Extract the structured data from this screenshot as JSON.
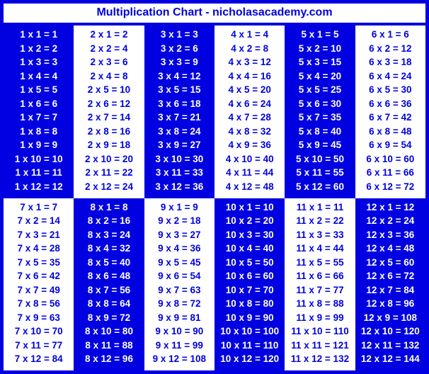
{
  "title": "Multiplication Chart - nicholasacademy.com",
  "chart_data": {
    "type": "table",
    "title": "Multiplication Chart - nicholasacademy.com",
    "multiplicands": [
      1,
      2,
      3,
      4,
      5,
      6,
      7,
      8,
      9,
      10,
      11,
      12
    ],
    "multipliers": [
      1,
      2,
      3,
      4,
      5,
      6,
      7,
      8,
      9,
      10,
      11,
      12
    ],
    "series": [
      {
        "name": "1",
        "values": [
          1,
          2,
          3,
          4,
          5,
          6,
          7,
          8,
          9,
          10,
          11,
          12
        ]
      },
      {
        "name": "2",
        "values": [
          2,
          4,
          6,
          8,
          10,
          12,
          14,
          16,
          18,
          20,
          22,
          24
        ]
      },
      {
        "name": "3",
        "values": [
          3,
          6,
          9,
          12,
          15,
          18,
          21,
          24,
          27,
          30,
          33,
          36
        ]
      },
      {
        "name": "4",
        "values": [
          4,
          8,
          12,
          16,
          20,
          24,
          28,
          32,
          36,
          40,
          44,
          48
        ]
      },
      {
        "name": "5",
        "values": [
          5,
          10,
          15,
          20,
          25,
          30,
          35,
          40,
          45,
          50,
          55,
          60
        ]
      },
      {
        "name": "6",
        "values": [
          6,
          12,
          18,
          24,
          30,
          36,
          42,
          48,
          54,
          60,
          66,
          72
        ]
      },
      {
        "name": "7",
        "values": [
          7,
          14,
          21,
          28,
          35,
          42,
          49,
          56,
          63,
          70,
          77,
          84
        ]
      },
      {
        "name": "8",
        "values": [
          8,
          16,
          24,
          32,
          40,
          48,
          56,
          64,
          72,
          80,
          88,
          96
        ]
      },
      {
        "name": "9",
        "values": [
          9,
          18,
          27,
          36,
          45,
          54,
          63,
          72,
          81,
          90,
          99,
          108
        ]
      },
      {
        "name": "10",
        "values": [
          10,
          20,
          30,
          40,
          50,
          60,
          70,
          80,
          90,
          100,
          110,
          120
        ]
      },
      {
        "name": "11",
        "values": [
          11,
          22,
          33,
          44,
          55,
          66,
          77,
          88,
          99,
          110,
          121,
          132
        ]
      },
      {
        "name": "12",
        "values": [
          12,
          24,
          36,
          48,
          60,
          72,
          84,
          96,
          108,
          120,
          132,
          144
        ]
      }
    ]
  }
}
